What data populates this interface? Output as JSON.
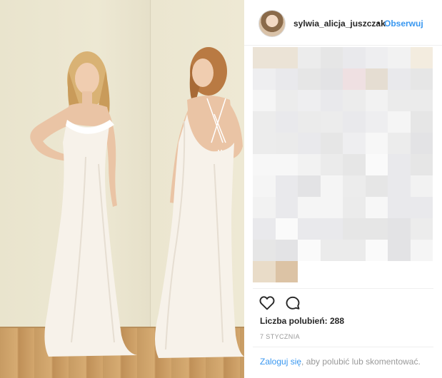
{
  "post": {
    "username": "sylwia_alicja_juszczak",
    "separator": "•",
    "follow_label": "Obserwuj",
    "likes_text": "Liczba polubień: 288",
    "date_text": "7 stycznia",
    "login_link": "Zaloguj się",
    "login_rest": ", aby polubić lub skomentować."
  },
  "icons": {
    "like": "heart-icon",
    "comment": "comment-bubble-icon"
  },
  "colors": {
    "link_blue": "#3897f0",
    "text_dark": "#262626",
    "text_muted": "#999999",
    "border": "#efefef"
  }
}
